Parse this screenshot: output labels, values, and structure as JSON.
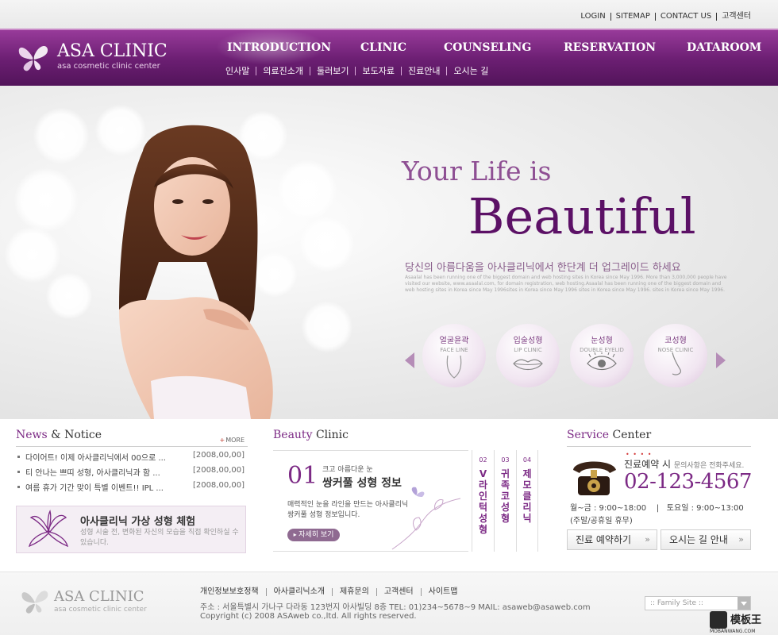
{
  "utility_links": [
    "LOGIN",
    "SITEMAP",
    "CONTACT US",
    "고객센터"
  ],
  "brand": {
    "name": "ASA CLINIC",
    "tagline": "asa cosmetic clinic center"
  },
  "main_nav": [
    "INTRODUCTION",
    "CLINIC",
    "COUNSELING",
    "RESERVATION",
    "DATAROOM"
  ],
  "active_nav": "INTRODUCTION",
  "sub_nav": [
    "인사말",
    "의료진소개",
    "둘러보기",
    "보도자료",
    "진료안내",
    "오시는 길"
  ],
  "hero": {
    "line1": "Your Life is",
    "line2": "Beautiful",
    "korean": "당신의 아름다움을 아사클리닉에서 한단계 더 업그레이드 하세요",
    "description": "Asaalal has been running one of the biggest domain and web hosting sites in Korea since May 1996. More than 3,000,000 people have visited our website, www.asaalal.com, for domain registration, web hosting.Asaalal has been running one of the biggest domain and web hosting sites in Korea since May 1996sites in Korea since May 1996 sites in Korea since May 1996. sites in Korea since May 1996."
  },
  "services": [
    {
      "ko": "얼굴윤곽",
      "en": "FACE LINE",
      "icon": "face-outline-icon"
    },
    {
      "ko": "입술성형",
      "en": "LIP CLINIC",
      "icon": "lips-icon"
    },
    {
      "ko": "눈성형",
      "en": "DOUBLE EYELID",
      "icon": "eye-icon"
    },
    {
      "ko": "코성형",
      "en": "NOSE CLINIC",
      "icon": "nose-icon"
    }
  ],
  "news": {
    "title_main": "News",
    "title_amp": "&",
    "title_rest": "Notice",
    "more": "MORE",
    "items": [
      {
        "title": "다이어트! 이제 아사클리닉에서 00으로 ...",
        "date": "[2008,00,00]"
      },
      {
        "title": "티 안나는 쁘띠 성형, 아사클리닉과 함 ...",
        "date": "[2008,00,00]"
      },
      {
        "title": "여름 휴가 기간 맞이 특별 이벤트!! IPL ...",
        "date": "[2008,00,00]"
      }
    ],
    "promo_title": "아사클리닉 가상 성형 체험",
    "promo_desc": "성형 시술 전, 변화된 자신의 모습을 직접 확인하실 수 있습니다."
  },
  "beauty": {
    "title_accent": "Beauty",
    "title_rest": "Clinic",
    "number": "01",
    "subtitle": "크고 아름다운 눈",
    "main": "쌍커풀 성형 정보",
    "desc": "매력적인 눈을 라인을 만드는 아사클리닉 쌍커풀 성형 정보입니다.",
    "button": "자세히 보기",
    "tabs": [
      {
        "num": "02",
        "label": "V라인턱성형"
      },
      {
        "num": "03",
        "label": "귀족코성형"
      },
      {
        "num": "04",
        "label": "제모클리닉"
      }
    ]
  },
  "service_center": {
    "title_accent": "Service",
    "title_rest": "Center",
    "label": "진료예약 시",
    "note": "문의사항은 전화주세요.",
    "phone": "02-123-4567",
    "hours_weekday": "월~금 : 9:00~18:00",
    "hours_sat": "토요일 : 9:00~13:00",
    "closed": "(주말/공휴일 휴무)",
    "button_reserve": "진료 예약하기",
    "button_directions": "오시는 길 안내"
  },
  "footer": {
    "links": [
      "개인정보보호정책",
      "아사클리닉소개",
      "제휴문의",
      "고객센터",
      "사이트맵"
    ],
    "address": "주소 : 서울특별시 가나구 다라동 123번지 아사빌딩 8층  TEL: 01)234~5678~9 MAIL: asaweb@asaweb.com",
    "copyright": "Copyright (c) 2008 ASAweb  co.,ltd. All rights reserved.",
    "family_site": ":: Family Site ::"
  },
  "watermark": {
    "name": "模板王",
    "url": "MOBANWANG.COM"
  },
  "colors": {
    "brand_purple": "#6b1e72",
    "accent_purple": "#7c2a85",
    "light_purple": "#f4eef4"
  }
}
